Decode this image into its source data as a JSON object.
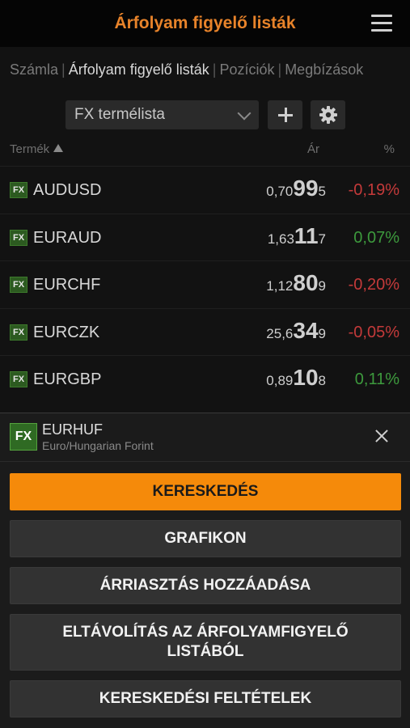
{
  "header": {
    "title": "Árfolyam figyelő listák",
    "menu_icon": "hamburger-menu-icon"
  },
  "tabs": [
    {
      "label": "Számla",
      "active": false
    },
    {
      "label": "Árfolyam figyelő listák",
      "active": true
    },
    {
      "label": "Pozíciók",
      "active": false
    },
    {
      "label": "Megbízások",
      "active": false
    }
  ],
  "watchlist_selector": {
    "value": "FX termélista",
    "icons": [
      "chevron-down-icon",
      "plus-icon",
      "gear-icon"
    ]
  },
  "columns": {
    "product": "Termék",
    "price": "Ár",
    "percent": "%"
  },
  "rows": [
    {
      "badge": "FX",
      "symbol": "AUDUSD",
      "price_pre": "0,70",
      "price_big": "99",
      "price_post": "5",
      "change": "-0,19%",
      "trend": "neg"
    },
    {
      "badge": "FX",
      "symbol": "EURAUD",
      "price_pre": "1,63",
      "price_big": "11",
      "price_post": "7",
      "change": "0,07%",
      "trend": "pos"
    },
    {
      "badge": "FX",
      "symbol": "EURCHF",
      "price_pre": "1,12",
      "price_big": "80",
      "price_post": "9",
      "change": "-0,20%",
      "trend": "neg"
    },
    {
      "badge": "FX",
      "symbol": "EURCZK",
      "price_pre": "25,6",
      "price_big": "34",
      "price_post": "9",
      "change": "-0,05%",
      "trend": "neg"
    },
    {
      "badge": "FX",
      "symbol": "EURGBP",
      "price_pre": "0,89",
      "price_big": "10",
      "price_post": "8",
      "change": "0,11%",
      "trend": "pos"
    }
  ],
  "sheet": {
    "badge": "FX",
    "symbol": "EURHUF",
    "description": "Euro/Hungarian Forint",
    "actions": [
      {
        "label": "KERESKEDÉS"
      },
      {
        "label": "GRAFIKON"
      },
      {
        "label": "ÁRRIASZTÁS HOZZÁADÁSA"
      },
      {
        "label": "ELTÁVOLÍTÁS AZ ÁRFOLYAMFIGYELŐ LISTÁBÓL"
      },
      {
        "label": "KERESKEDÉSI FELTÉTELEK"
      }
    ]
  },
  "colors": {
    "accent": "#e8832a",
    "primary_button": "#f58a0a",
    "negative": "#c43a3a",
    "positive": "#3d9a3d",
    "fx_badge": "#2f6a23"
  }
}
